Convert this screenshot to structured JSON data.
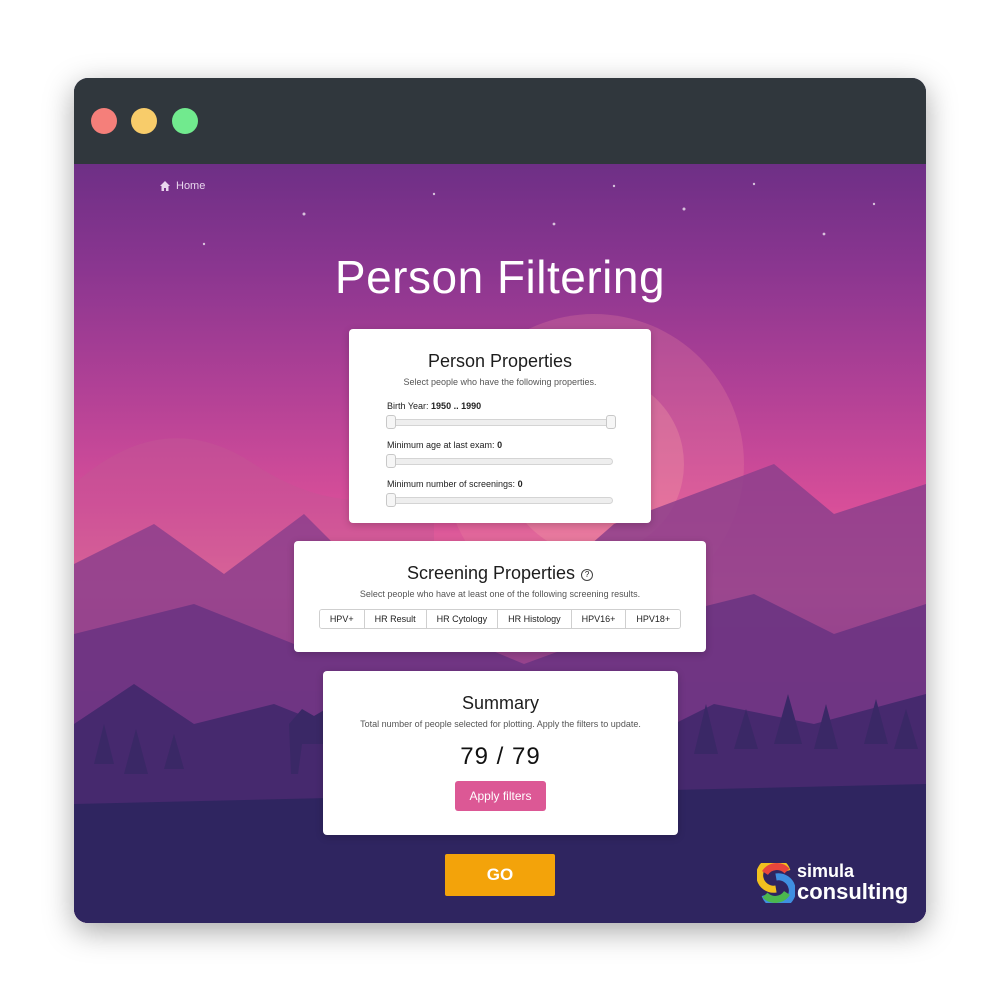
{
  "breadcrumb": {
    "home": "Home"
  },
  "page": {
    "title": "Person Filtering"
  },
  "person_properties": {
    "title": "Person Properties",
    "subtitle": "Select people who have the following properties.",
    "birth_year_label": "Birth Year:",
    "birth_year_value": "1950 .. 1990",
    "min_age_label": "Minimum age at last exam:",
    "min_age_value": "0",
    "min_screenings_label": "Minimum number of screenings:",
    "min_screenings_value": "0"
  },
  "screening_properties": {
    "title": "Screening Properties",
    "help_symbol": "?",
    "subtitle": "Select people who have at least one of the following screening results.",
    "options": [
      "HPV+",
      "HR Result",
      "HR Cytology",
      "HR Histology",
      "HPV16+",
      "HPV18+"
    ]
  },
  "summary": {
    "title": "Summary",
    "subtitle": "Total number of people selected for plotting. Apply the filters to update.",
    "count": "79 / 79",
    "apply_label": "Apply filters"
  },
  "go_label": "GO",
  "logo": {
    "line1": "simula",
    "line2": "consulting"
  },
  "colors": {
    "accent_pink": "#dc5895",
    "go_orange": "#f3a30a",
    "titlebar": "#30373d"
  }
}
